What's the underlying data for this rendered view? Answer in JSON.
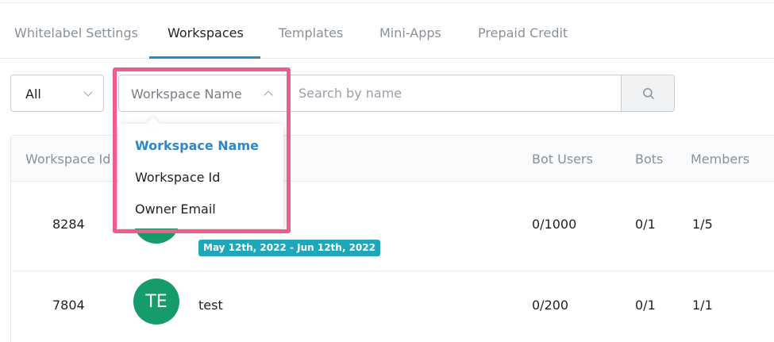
{
  "tabs": [
    {
      "label": "Whitelabel Settings",
      "active": false
    },
    {
      "label": "Workspaces",
      "active": true
    },
    {
      "label": "Templates",
      "active": false
    },
    {
      "label": "Mini-Apps",
      "active": false
    },
    {
      "label": "Prepaid Credit",
      "active": false
    }
  ],
  "filters": {
    "scope": {
      "value": "All"
    },
    "field": {
      "value": "Workspace Name"
    },
    "search": {
      "value": "",
      "placeholder": "Search by name"
    }
  },
  "dropdown": {
    "options": [
      {
        "label": "Workspace Name",
        "selected": true
      },
      {
        "label": "Workspace Id",
        "selected": false
      },
      {
        "label": "Owner Email",
        "selected": false
      }
    ]
  },
  "table": {
    "columns": [
      "Workspace Id",
      "Bot Users",
      "Bots",
      "Members"
    ],
    "rows": [
      {
        "id": "8284",
        "avatar": "",
        "name": "",
        "badge": "May 12th, 2022 - Jun 12th, 2022",
        "bot_users": "0/1000",
        "bots": "0/1",
        "members": "1/5"
      },
      {
        "id": "7804",
        "avatar": "TE",
        "name": "test",
        "badge": "",
        "bot_users": "0/200",
        "bots": "0/1",
        "members": "1/1"
      }
    ]
  },
  "colors": {
    "accent": "#2f86c9",
    "avatar": "#169b6b",
    "badge": "#1ea7b8",
    "highlight": "#ec5f8c"
  },
  "icons": {
    "search": "search-icon",
    "chevron": "chevron-down-icon"
  }
}
